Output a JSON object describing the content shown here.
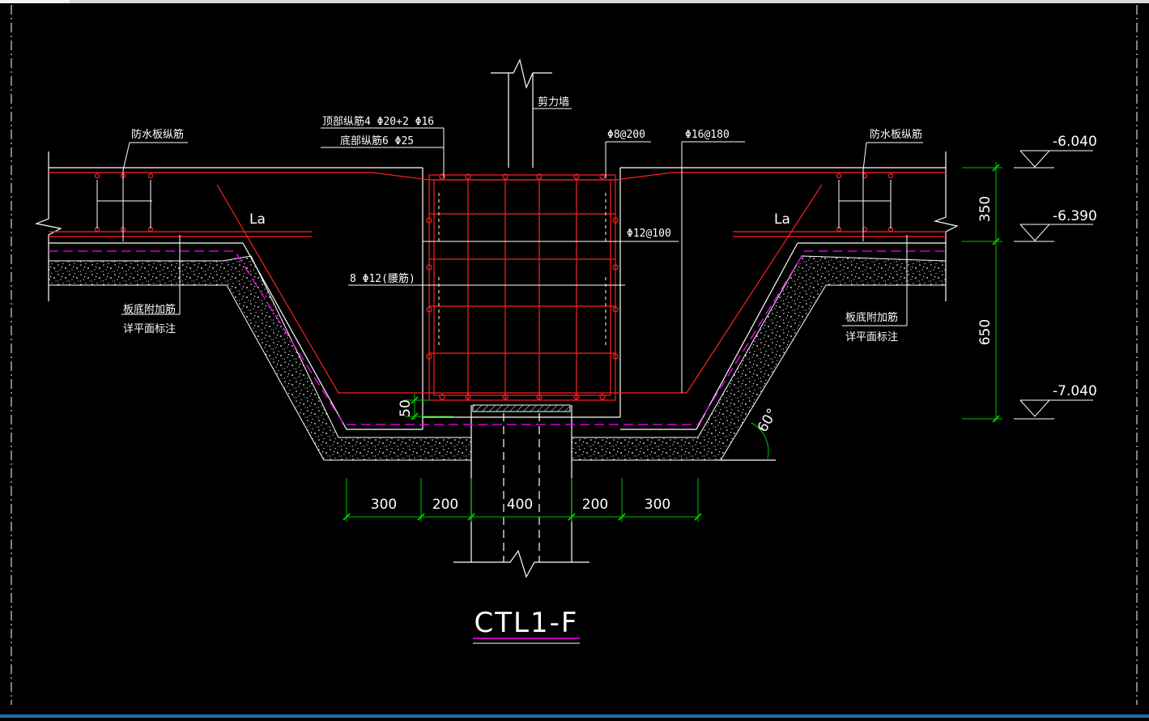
{
  "drawing": {
    "title": "CTL1-F",
    "colors": {
      "background": "#000000",
      "outline": "#ffffff",
      "rebar": "#ff2020",
      "dimension": "#00c000",
      "waterproof": "#ff00ff"
    },
    "labels": {
      "shear_wall": "剪力墙",
      "top_rebar": "顶部纵筋4 Φ20+2 Φ16",
      "bottom_rebar": "底部纵筋6 Φ25",
      "stirrup": "Φ8@200",
      "side_bar": "Φ16@180",
      "waist_bar_spacing": "Φ12@100",
      "waist_bar": "8 Φ12(腰筋)",
      "slab_rebar_left": "防水板纵筋",
      "slab_rebar_right": "防水板纵筋",
      "anchor_left": "La",
      "anchor_right": "La",
      "additional_left_1": "板底附加筋",
      "additional_left_2": "详平面标注",
      "additional_right_1": "板底附加筋",
      "additional_right_2": "详平面标注",
      "angle": "60°"
    },
    "elevations": [
      "-6.040",
      "-6.390",
      "-7.040"
    ],
    "vertical_dims": [
      "350",
      "650"
    ],
    "cover_dim": "50",
    "horizontal_dims": [
      "300",
      "200",
      "400",
      "200",
      "300"
    ]
  }
}
